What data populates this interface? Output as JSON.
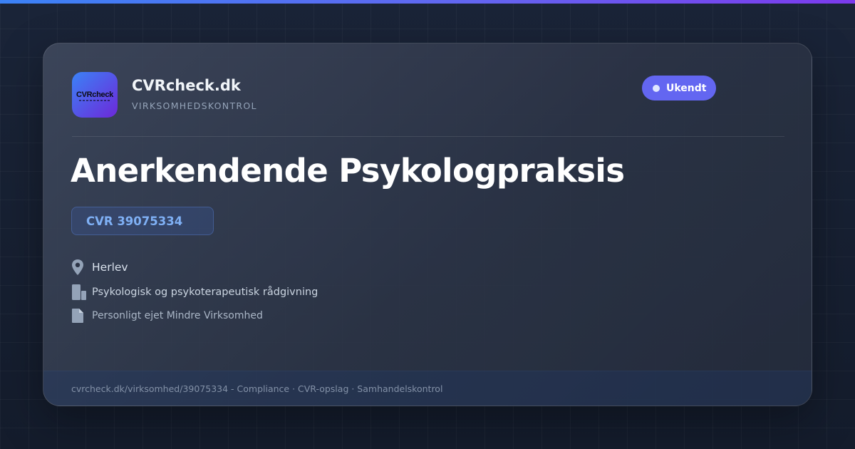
{
  "brand": {
    "logo_text": "CVRcheck",
    "name": "CVRcheck.dk",
    "tagline": "VIRKSOMHEDSKONTROL"
  },
  "status": {
    "label": "Ukendt"
  },
  "company": {
    "name": "Anerkendende Psykologpraksis",
    "cvr": "CVR 39075334",
    "location": "Herlev",
    "industry": "Psykologisk og psykoterapeutisk rådgivning",
    "company_type": "Personligt ejet Mindre Virksomhed"
  },
  "footer": {
    "text": "cvrcheck.dk/virksomhed/39075334 - Compliance · CVR-opslag · Samhandelskontrol"
  },
  "icons": {
    "location": "map-pin-icon",
    "industry": "building-icon",
    "company_type": "document-icon"
  },
  "colors": {
    "accent": "#6366f1",
    "cvr_text": "#7fb0f5",
    "background": "#161f33"
  }
}
